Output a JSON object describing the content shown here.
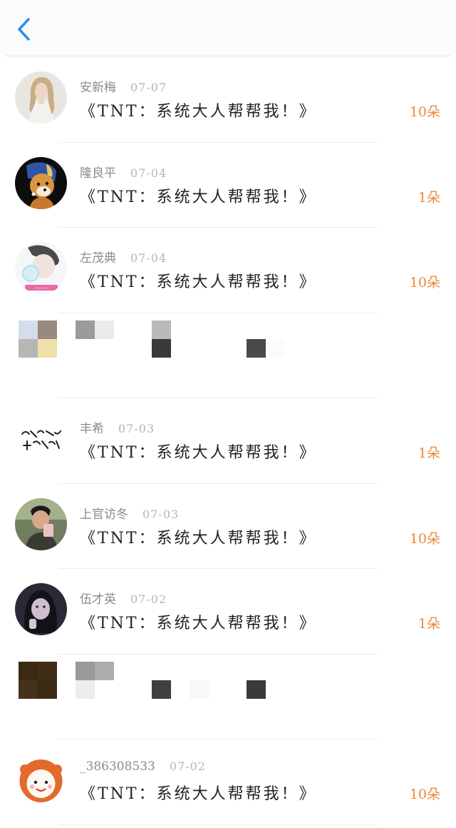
{
  "header": {
    "back_icon": "chevron-left-icon",
    "accent_color": "#2a8ff2"
  },
  "gifts": [
    {
      "name": "安新梅",
      "date": "07-07",
      "title": "《TNT：系统大人帮帮我！》",
      "amount": "10朵",
      "avatar": "portrait-woman-light"
    },
    {
      "name": "隆良平",
      "date": "07-04",
      "title": "《TNT：系统大人帮帮我！》",
      "amount": "1朵",
      "avatar": "dog-pearl-earring"
    },
    {
      "name": "左茂典",
      "date": "07-04",
      "title": "《TNT：系统大人帮帮我！》",
      "amount": "10朵",
      "avatar": "girl-blowing-bubble"
    },
    {
      "mosaic": true
    },
    {
      "name": "丰希",
      "date": "07-03",
      "title": "《TNT：系统大人帮帮我！》",
      "amount": "1朵",
      "avatar": "calligraphy-text"
    },
    {
      "name": "上官访冬",
      "date": "07-03",
      "title": "《TNT：系统大人帮帮我！》",
      "amount": "10朵",
      "avatar": "man-selfie"
    },
    {
      "name": "伍才英",
      "date": "07-02",
      "title": "《TNT：系统大人帮帮我！》",
      "amount": "1朵",
      "avatar": "girl-dark-hair"
    },
    {
      "mosaic": true
    },
    {
      "name": "_386308533",
      "date": "07-02",
      "title": "《TNT：系统大人帮帮我！》",
      "amount": "10朵",
      "avatar": "cartoon-lion"
    }
  ],
  "colors": {
    "amount": "#e98a3c",
    "name": "#8a8a8a",
    "date": "#b5b5b5",
    "title": "#222222"
  }
}
